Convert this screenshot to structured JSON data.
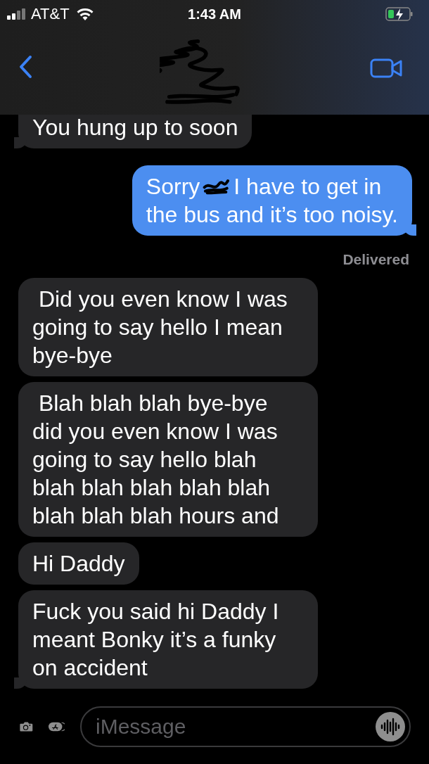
{
  "status_bar": {
    "carrier": "AT&T",
    "time": "1:43 AM",
    "charging": true
  },
  "header": {
    "redacted": true
  },
  "messages": [
    {
      "kind": "received",
      "tail": true,
      "clipped": true,
      "parts": [
        "You hung up to soon"
      ]
    },
    {
      "kind": "sent",
      "tail": true,
      "clipped": false,
      "parts": [
        "Sorry",
        "I have to get in",
        "the bus and it’s too noisy."
      ]
    },
    {
      "kind": "status",
      "parts": [
        "Delivered"
      ]
    },
    {
      "kind": "received",
      "tail": false,
      "clipped": false,
      "parts": [
        " Did you even know I was going to say hello I mean bye-bye"
      ]
    },
    {
      "kind": "received",
      "tail": false,
      "clipped": false,
      "parts": [
        " Blah blah blah bye-bye did you even know I was going to say hello blah blah blah blah blah blah blah blah blah hours and"
      ]
    },
    {
      "kind": "received",
      "tail": false,
      "clipped": false,
      "parts": [
        "Hi Daddy"
      ]
    },
    {
      "kind": "received",
      "tail": true,
      "clipped": false,
      "parts": [
        "Fuck you said hi Daddy I meant Bonky it’s a funky on accident"
      ]
    }
  ],
  "input": {
    "placeholder": "iMessage"
  }
}
